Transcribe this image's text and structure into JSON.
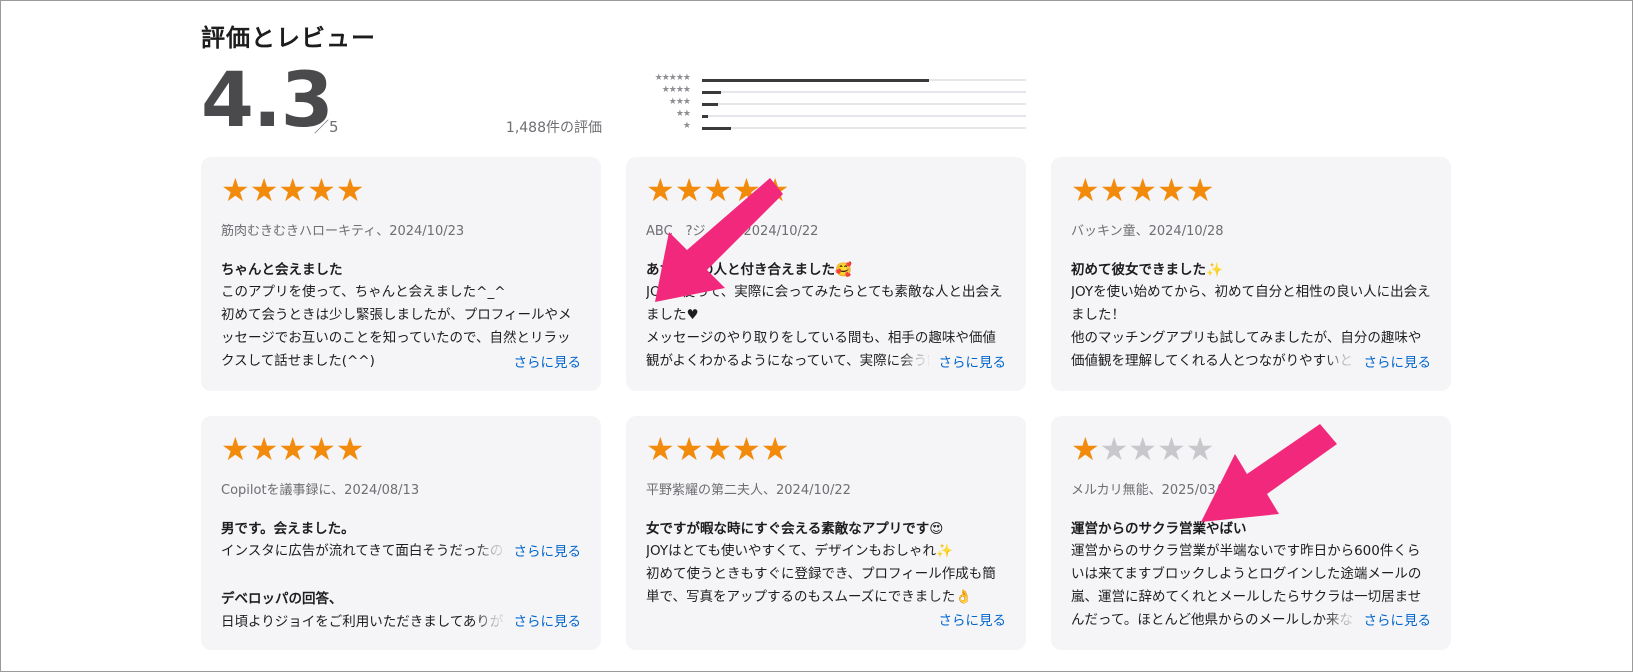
{
  "section_title": "評価とレビュー",
  "summary": {
    "rating": "4.3",
    "out_of": "／5",
    "count_label": "1,488件の評価"
  },
  "histogram": [
    {
      "stars": "★★★★★",
      "fraction": 0.7
    },
    {
      "stars": "★★★★",
      "fraction": 0.06
    },
    {
      "stars": "★★★",
      "fraction": 0.05
    },
    {
      "stars": "★★",
      "fraction": 0.02
    },
    {
      "stars": "★",
      "fraction": 0.09
    }
  ],
  "colors": {
    "star_on": "#f28a0c",
    "star_off": "#c7c7cc",
    "link": "#0066cc",
    "card_bg": "#f5f5f7",
    "annotation_arrow": "#f2287c"
  },
  "more_label": "さらに見る",
  "reviews": [
    {
      "rating": 5,
      "meta": "筋肉むきむきハローキティ、2024/10/23",
      "title": "ちゃんと会えました",
      "body": "このアプリを使って、ちゃんと会えました^_^\n初めて会うときは少し緊張しましたが、プロフィールやメッセージでお互いのことを知っていたので、自然とリラックスして話せました(^^)"
    },
    {
      "rating": 5,
      "meta": "ABC　?ジ　す、2024/10/22",
      "title": "あたし　の人と付き合えました🥰",
      "body": "JOYを使って、実際に会ってみたらとても素敵な人と出会えました♥\nメッセージのやり取りをしている間も、相手の趣味や価値観がよくわかるようになっていて、実際に会う前"
    },
    {
      "rating": 5,
      "meta": "バッキン童、2024/10/28",
      "title": "初めて彼女できました✨",
      "body": "JOYを使い始めてから、初めて自分と相性の良い人に出会えました！\n他のマッチングアプリも試してみましたが、自分の趣味や価値観を理解してくれる人とつながりやすいと感じ"
    },
    {
      "rating": 5,
      "meta": "Copilotを議事録に、2024/08/13",
      "title": "男です。会えました。",
      "body": "インスタに広告が流れてきて面白そうだったので",
      "developer_title": "デベロッパの回答、",
      "developer_body": "日頃よりジョイをご利用いただきましてありがとう"
    },
    {
      "rating": 5,
      "meta": "平野紫耀の第二夫人、2024/10/22",
      "title": "女ですが暇な時にすぐ会える素敵なアプリです😍",
      "body": "JOYはとても使いやすくて、デザインもおしゃれ✨\n初めて使うときもすぐに登録でき、プロフィール作成も簡単で、写真をアップするのもスムーズにできました👌"
    },
    {
      "rating": 1,
      "meta": "メルカリ無能、2025/03/25",
      "title": "運営からのサクラ営業やばい",
      "body": "運営からのサクラ営業が半端ないです昨日から600件くらいは来てますブロックしようとログインした途端メールの嵐、運営に辞めてくれとメールしたらサクラは一切居ませんだって。ほとんど他県からのメールしか来ない"
    }
  ]
}
